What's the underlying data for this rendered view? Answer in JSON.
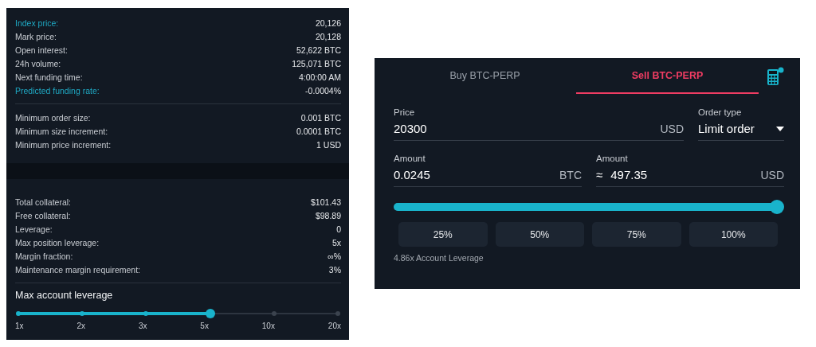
{
  "market_info": {
    "groups": [
      [
        {
          "label": "Index price:",
          "value": "20,126",
          "highlighted": true
        },
        {
          "label": "Mark price:",
          "value": "20,128",
          "highlighted": false
        },
        {
          "label": "Open interest:",
          "value": "52,622 BTC",
          "highlighted": false
        },
        {
          "label": "24h volume:",
          "value": "125,071 BTC",
          "highlighted": false
        },
        {
          "label": "Next funding time:",
          "value": "4:00:00 AM",
          "highlighted": false
        },
        {
          "label": "Predicted funding rate:",
          "value": "-0.0004%",
          "highlighted": true
        }
      ],
      [
        {
          "label": "Minimum order size:",
          "value": "0.001 BTC",
          "highlighted": false
        },
        {
          "label": "Minimum size increment:",
          "value": "0.0001 BTC",
          "highlighted": false
        },
        {
          "label": "Minimum price increment:",
          "value": "1 USD",
          "highlighted": false
        }
      ]
    ]
  },
  "account": {
    "rows": [
      {
        "label": "Total collateral:",
        "value": "$101.43"
      },
      {
        "label": "Free collateral:",
        "value": "$98.89"
      },
      {
        "label": "Leverage:",
        "value": "0"
      },
      {
        "label": "Max position leverage:",
        "value": "5x"
      },
      {
        "label": "Margin fraction:",
        "value": "∞%"
      },
      {
        "label": "Maintenance margin requirement:",
        "value": "3%"
      }
    ],
    "leverage_title": "Max account leverage",
    "leverage_stops": [
      {
        "label": "1x",
        "selected": false
      },
      {
        "label": "2x",
        "selected": false
      },
      {
        "label": "3x",
        "selected": false
      },
      {
        "label": "5x",
        "selected": true
      },
      {
        "label": "10x",
        "selected": false
      },
      {
        "label": "20x",
        "selected": false
      }
    ]
  },
  "order_form": {
    "tabs": [
      {
        "label": "Buy BTC-PERP",
        "selected": false
      },
      {
        "label": "Sell BTC-PERP",
        "selected": true
      }
    ],
    "price": {
      "label": "Price",
      "value": "20300",
      "unit": "USD"
    },
    "order_type": {
      "label": "Order type",
      "value": "Limit order"
    },
    "amount_btc": {
      "label": "Amount",
      "value": "0.0245",
      "unit": "BTC"
    },
    "amount_usd": {
      "label": "Amount",
      "prefix": "≈",
      "value": "497.35",
      "unit": "USD"
    },
    "amount_slider": {
      "level": 1
    },
    "percent_buttons": [
      "25%",
      "50%",
      "75%",
      "100%"
    ],
    "leverage_note": "4.86x Account Leverage"
  }
}
